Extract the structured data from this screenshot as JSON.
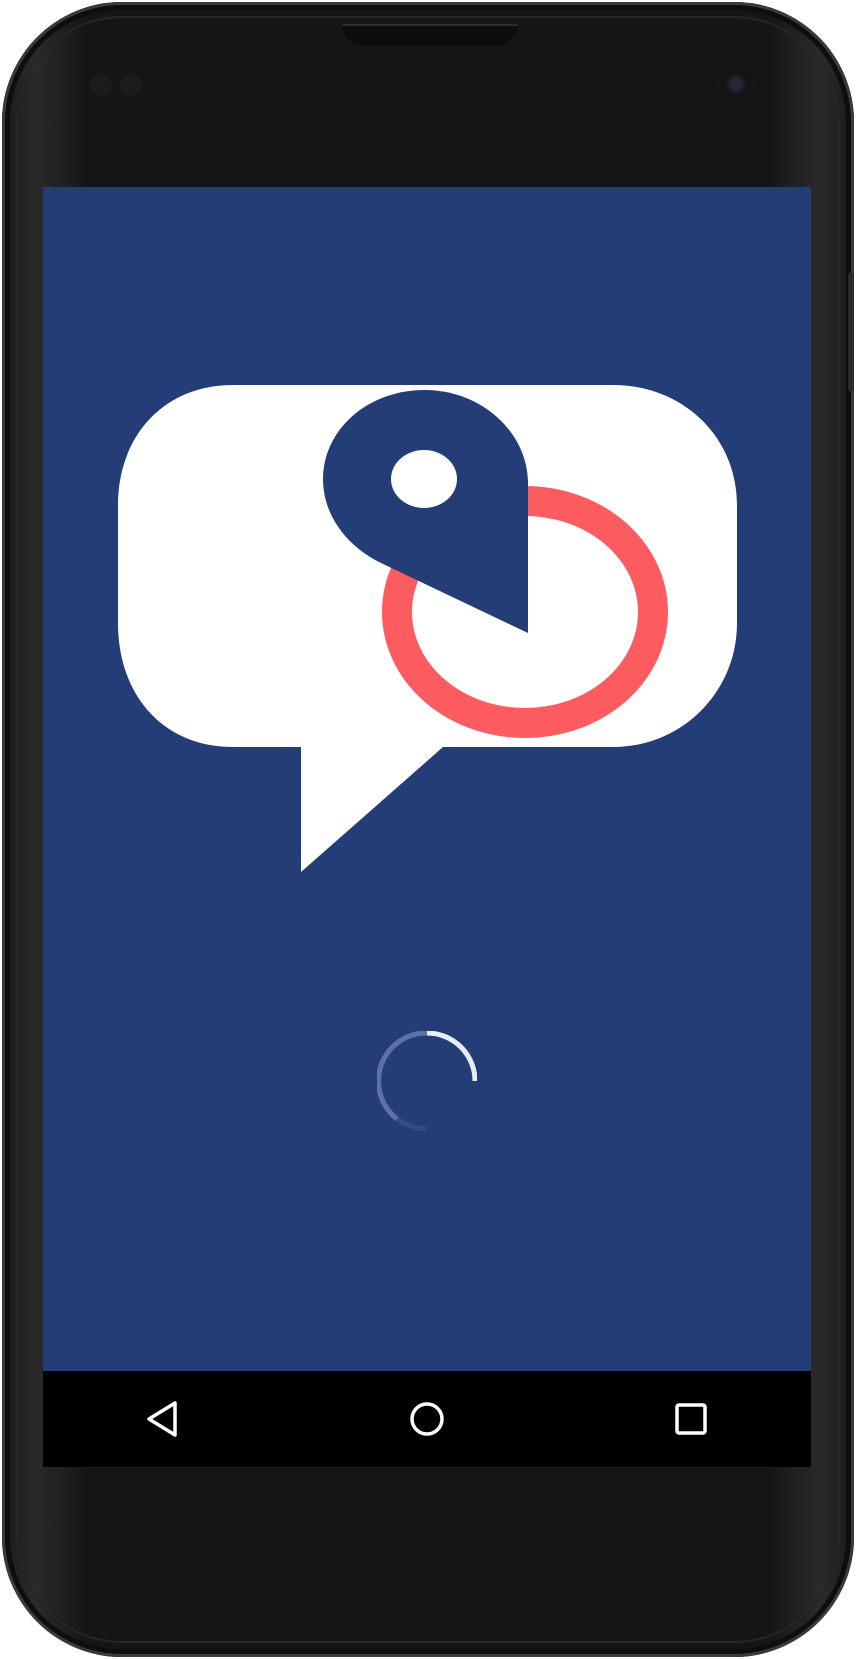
{
  "app": {
    "background_color": "#243d76",
    "bubble_color": "#ffffff",
    "pin_color": "#243d76",
    "ring_color": "#fc5c5f"
  },
  "loading": {
    "state": "loading",
    "icon": "spinner-icon"
  },
  "navigation": {
    "back_icon": "back-triangle-icon",
    "home_icon": "home-circle-icon",
    "recents_icon": "recents-square-icon"
  }
}
